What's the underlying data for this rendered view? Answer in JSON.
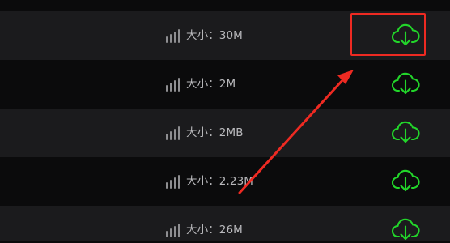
{
  "download_list": {
    "accent_color": "#22d62a",
    "annotation_color": "#ee2a22",
    "rows": [
      {
        "size_label": "大小：30M",
        "icon": "cloud-download-icon",
        "signal_icon": "signal-bars-icon"
      },
      {
        "size_label": "大小：2M",
        "icon": "cloud-download-icon",
        "signal_icon": "signal-bars-icon"
      },
      {
        "size_label": "大小：2MB",
        "icon": "cloud-download-icon",
        "signal_icon": "signal-bars-icon"
      },
      {
        "size_label": "大小：2.23M",
        "icon": "cloud-download-icon",
        "signal_icon": "signal-bars-icon"
      },
      {
        "size_label": "大小：26M",
        "icon": "cloud-download-icon",
        "signal_icon": "signal-bars-icon"
      }
    ]
  }
}
